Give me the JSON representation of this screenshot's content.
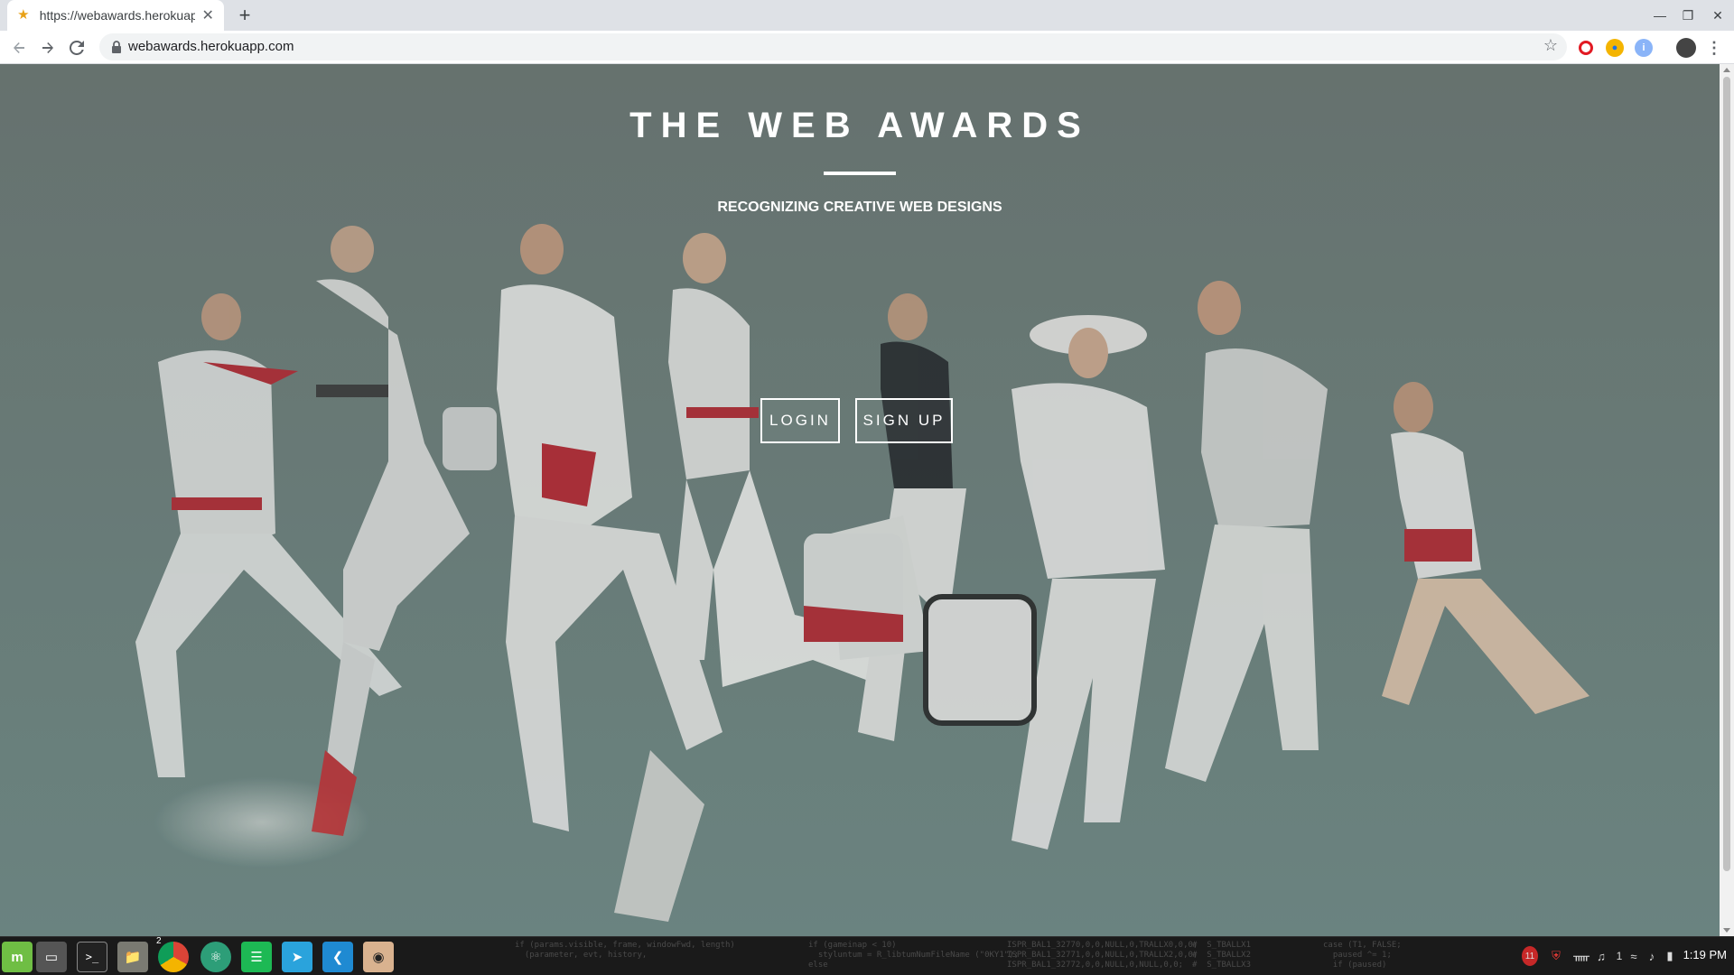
{
  "browser": {
    "tab_title": "https://webawards.herokuapp.com",
    "url": "webawards.herokuapp.com"
  },
  "page": {
    "title": "THE WEB AWARDS",
    "subtitle": "RECOGNIZING CREATIVE WEB DESIGNS",
    "login_label": "LOGIN",
    "signup_label": "SIGN UP"
  },
  "taskbar": {
    "chrome_badge": "2",
    "tray_notifications": "11",
    "tray_count": "1",
    "clock": "1:19 PM",
    "bg_code": [
      "if (params.visible, frame, windowFwd, length)",
      "  (parameter, evt, history,",
      "if (gameinap < 10)",
      "  styluntum = R_libtumNumFileName (\"0KY1\");",
      "else",
      "ISPR_BAL1_32770,0,0,NULL,0,TRALLX0,0,0;",
      "ISPR_BAL1_32771,0,0,NULL,0,TRALLX2,0,0;",
      "ISPR_BAL1_32772,0,0,NULL,0,NULL,0,0;",
      "#  S_TBALLX1",
      "#  S_TBALLX2",
      "#  S_TBALLX3",
      "case (T1, FALSE;",
      "  paused ^= 1;",
      "  if (paused)"
    ]
  },
  "colors": {
    "page_bg": "#6f8482",
    "accent_opera": "#e21a23",
    "accent_vscode": "#1f8ad2",
    "accent_mint": "#6fbe44",
    "accent_spotify": "#1db954"
  }
}
